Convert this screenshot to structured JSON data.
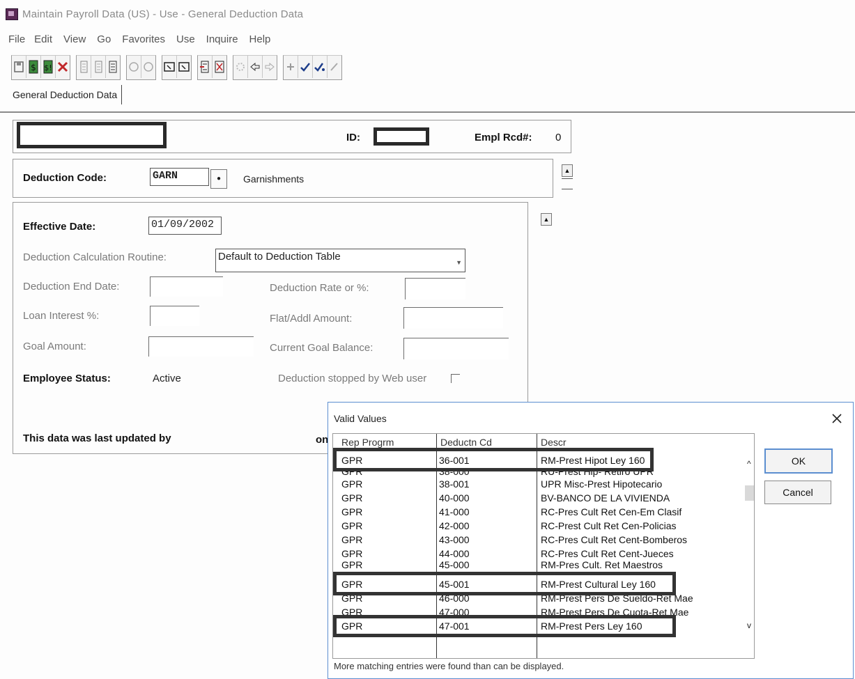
{
  "window": {
    "title": "Maintain Payroll Data (US) - Use - General Deduction Data"
  },
  "menu": [
    "File",
    "Edit",
    "View",
    "Go",
    "Favorites",
    "Use",
    "Inquire",
    "Help"
  ],
  "toolbar": {
    "groups": [
      [
        "save-icon",
        "next-in-list-icon",
        "previous-in-list-icon",
        "delete-icon"
      ],
      [
        "insert-row-icon",
        "delete-row-icon",
        "view-all-icon"
      ],
      [
        "lookup-icon",
        "lookup-alt-icon"
      ],
      [
        "window-icon",
        "window-alt-icon"
      ],
      [
        "update-icon",
        "correct-history-icon"
      ],
      [
        "refresh-icon",
        "back-icon",
        "forward-icon"
      ],
      [
        "add-icon",
        "check-icon",
        "check-all-icon",
        "edit-icon"
      ]
    ]
  },
  "tab": {
    "label": "General Deduction Data"
  },
  "header": {
    "id_label": "ID:",
    "empl_rcd_label": "Empl Rcd#:",
    "empl_rcd_value": "0"
  },
  "deduction": {
    "code_label": "Deduction Code:",
    "code_value": "GARN",
    "description": "Garnishments"
  },
  "details": {
    "effective_date_label": "Effective Date:",
    "effective_date_value": "01/09/2002",
    "calc_routine_label": "Deduction Calculation Routine:",
    "calc_routine_value": "Default to Deduction Table",
    "end_date_label": "Deduction End Date:",
    "rate_label": "Deduction Rate or %:",
    "loan_interest_label": "Loan Interest %:",
    "flat_amount_label": "Flat/Addl Amount:",
    "goal_amount_label": "Goal Amount:",
    "current_goal_label": "Current Goal Balance:",
    "employee_status_label": "Employee Status:",
    "employee_status_value": "Active",
    "stopped_label": "Deduction stopped by Web user",
    "last_updated_label": "This data was last updated by",
    "on_label": "on"
  },
  "dialog": {
    "title": "Valid Values",
    "close_glyph": "X",
    "columns": [
      "Rep Progrm",
      "Deductn Cd",
      "Descr"
    ],
    "rows": [
      {
        "prog": "GPR",
        "code": "36-001",
        "descr": "RM-Prest Hipot Ley 160"
      },
      {
        "prog": "GPR",
        "code": "38-000",
        "descr": "RU-Prest Hip- Retiro UPR"
      },
      {
        "prog": "GPR",
        "code": "38-001",
        "descr": "UPR Misc-Prest Hipotecario"
      },
      {
        "prog": "GPR",
        "code": "40-000",
        "descr": "BV-BANCO DE LA VIVIENDA"
      },
      {
        "prog": "GPR",
        "code": "41-000",
        "descr": "RC-Pres Cult Ret Cen-Em Clasif"
      },
      {
        "prog": "GPR",
        "code": "42-000",
        "descr": "RC-Prest Cult Ret Cen-Policias"
      },
      {
        "prog": "GPR",
        "code": "43-000",
        "descr": "RC-Pres Cult Ret Cent-Bomberos"
      },
      {
        "prog": "GPR",
        "code": "44-000",
        "descr": "RC-Pres Cult Ret Cent-Jueces"
      },
      {
        "prog": "GPR",
        "code": "45-000",
        "descr": "RM-Pres Cult. Ret Maestros"
      },
      {
        "prog": "GPR",
        "code": "45-001",
        "descr": "RM-Prest Cultural Ley 160"
      },
      {
        "prog": "GPR",
        "code": "46-000",
        "descr": "RM-Prest Pers De Sueldo-Ret Mae"
      },
      {
        "prog": "GPR",
        "code": "47-000",
        "descr": "RM-Prest Pers De Cuota-Ret Mae"
      },
      {
        "prog": "GPR",
        "code": "47-001",
        "descr": "RM-Prest Pers Ley 160"
      }
    ],
    "ok_label": "OK",
    "cancel_label": "Cancel",
    "footer": "More matching entries were found than can be displayed.",
    "scroll_up_glyph": "^",
    "scroll_down_glyph": "v",
    "scroll_left_glyph": "<",
    "scroll_right_glyph": ">"
  }
}
